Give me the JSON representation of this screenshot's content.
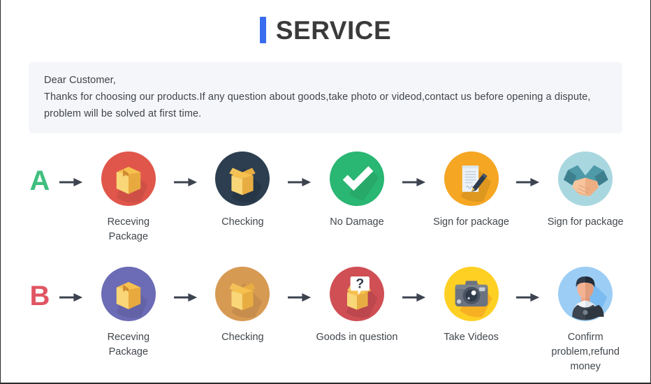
{
  "header": {
    "title": "SERVICE",
    "accent_color": "#3a6cf0"
  },
  "notice": {
    "greeting": "Dear Customer,",
    "line2": "Thanks for choosing our products.If any question about goods,take photo or videod,contact us before opening a dispute,",
    "line3": "problem will be solved at first time.",
    "background_color": "#f5f6fa"
  },
  "rows": [
    {
      "letter": "A",
      "letter_color": "#3fbf7f",
      "steps": [
        {
          "label": "Receving Package",
          "icon": "closed-box-red-icon",
          "circle_color": "#e0564b"
        },
        {
          "label": "Checking",
          "icon": "open-box-navy-icon",
          "circle_color": "#2c3e50"
        },
        {
          "label": "No Damage",
          "icon": "check-green-icon",
          "circle_color": "#2ab673"
        },
        {
          "label": "Sign for package",
          "icon": "document-pen-orange-icon",
          "circle_color": "#f5a623"
        },
        {
          "label": "Sign for package",
          "icon": "handshake-blue-icon",
          "circle_color": "#a9d7e0"
        }
      ]
    },
    {
      "letter": "B",
      "letter_color": "#e05562",
      "steps": [
        {
          "label": "Receving Package",
          "icon": "closed-box-purple-icon",
          "circle_color": "#6c6bb5"
        },
        {
          "label": "Checking",
          "icon": "open-box-tan-icon",
          "circle_color": "#d79a53"
        },
        {
          "label": "Goods in question",
          "icon": "question-box-red-icon",
          "circle_color": "#cf4f55"
        },
        {
          "label": "Take Videos",
          "icon": "camera-yellow-icon",
          "circle_color": "#ffd024"
        },
        {
          "label": "Confirm problem,refund money",
          "icon": "person-blue-icon",
          "circle_color": "#9ccdf5"
        }
      ]
    }
  ],
  "arrow": {
    "name": "right-arrow-icon",
    "color": "#3d4450"
  }
}
